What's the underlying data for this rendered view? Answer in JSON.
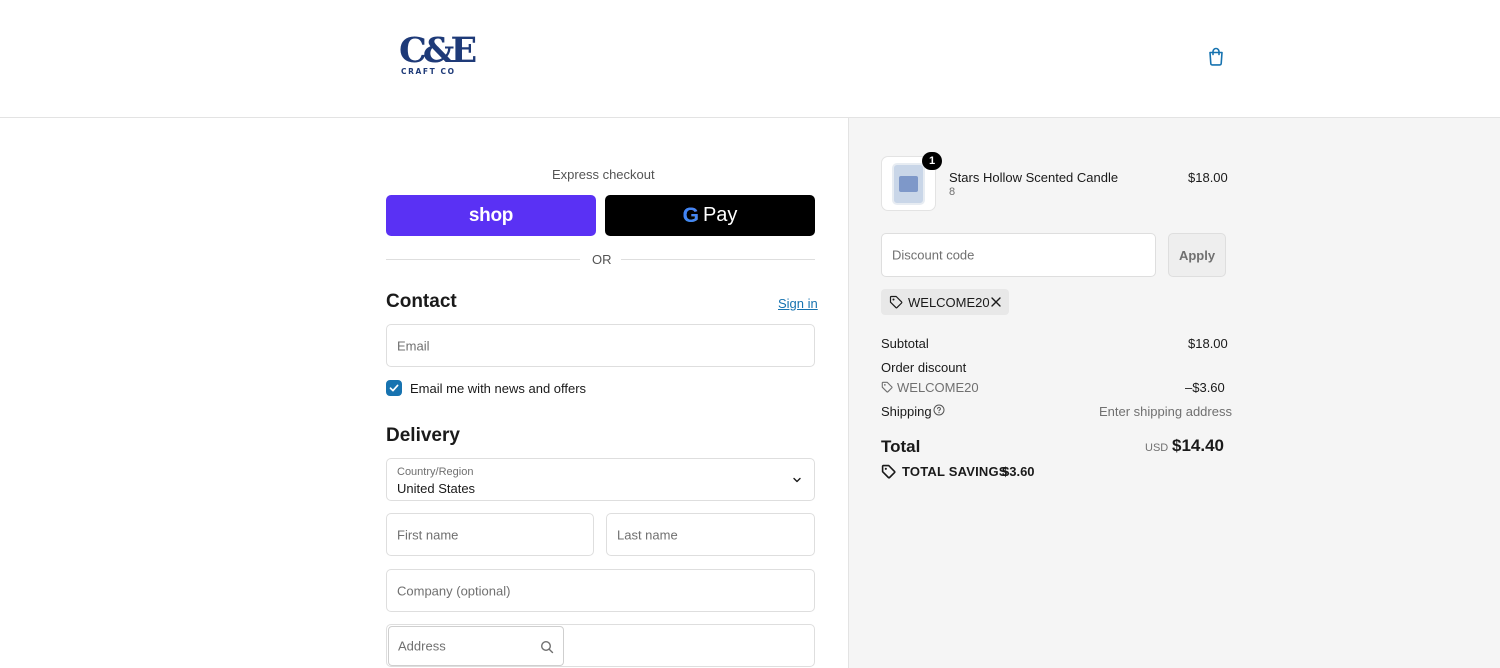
{
  "header": {
    "logo_mark": "C&E",
    "logo_sub": "CRAFT CO"
  },
  "express": {
    "label": "Express checkout",
    "shop_label": "shop",
    "gpay_g": "G",
    "gpay_label": "Pay",
    "or_label": "OR"
  },
  "contact": {
    "heading": "Contact",
    "sign_in": "Sign in",
    "email_placeholder": "Email",
    "marketing_checkbox_label": "Email me with news and offers",
    "marketing_checked": true
  },
  "delivery": {
    "heading": "Delivery",
    "country_label": "Country/Region",
    "country_value": "United States",
    "first_name_placeholder": "First name",
    "last_name_placeholder": "Last name",
    "company_placeholder": "Company (optional)",
    "address_placeholder": "Address"
  },
  "summary": {
    "item": {
      "quantity_badge": "1",
      "name": "Stars Hollow Scented Candle",
      "variant": "8",
      "price": "$18.00"
    },
    "discount_placeholder": "Discount code",
    "apply_label": "Apply",
    "applied_code": "WELCOME20",
    "subtotal_label": "Subtotal",
    "subtotal_value": "$18.00",
    "order_discount_label": "Order discount",
    "discount_code_line": "WELCOME20",
    "discount_value": "–$3.60",
    "shipping_label": "Shipping",
    "shipping_value": "Enter shipping address",
    "total_label": "Total",
    "total_currency": "USD",
    "total_value": "$14.40",
    "savings_label": "TOTAL SAVINGS",
    "savings_value": "$3.60"
  },
  "colors": {
    "shop_pay": "#5a31f4",
    "link": "#1773b0",
    "brand_navy": "#1e3a78"
  }
}
